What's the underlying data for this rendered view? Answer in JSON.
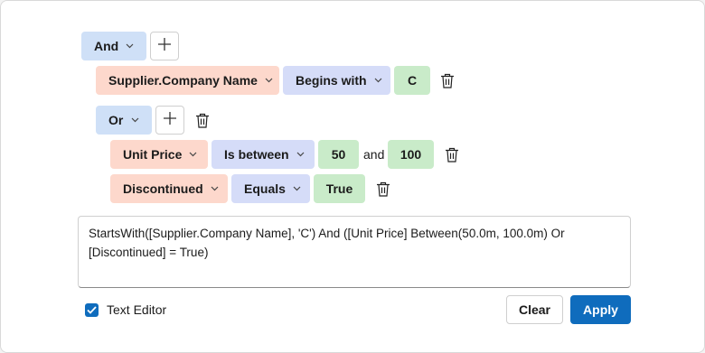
{
  "root_group": {
    "operator": "And"
  },
  "condition_1": {
    "field": "Supplier.Company Name",
    "operator": "Begins with",
    "value": "C"
  },
  "nested_group": {
    "operator": "Or"
  },
  "condition_2": {
    "field": "Unit Price",
    "operator": "Is between",
    "value_from": "50",
    "conjunction": "and",
    "value_to": "100"
  },
  "condition_3": {
    "field": "Discontinued",
    "operator": "Equals",
    "value": "True"
  },
  "text_editor": {
    "expression": "StartsWith([Supplier.Company Name], 'C') And ([Unit Price] Between(50.0m, 100.0m) Or [Discontinued] = True)"
  },
  "footer": {
    "text_editor_label": "Text Editor",
    "text_editor_checked": true,
    "clear_label": "Clear",
    "apply_label": "Apply"
  },
  "icons": {
    "add": "plus-icon",
    "delete": "trash-icon",
    "dropdown": "chevron-down-icon",
    "check": "checkmark-icon"
  },
  "colors": {
    "group": "#cfe0f7",
    "field": "#fdd8cc",
    "operator": "#d5dcf8",
    "value": "#c9ebc9",
    "accent": "#0f6cbd"
  }
}
